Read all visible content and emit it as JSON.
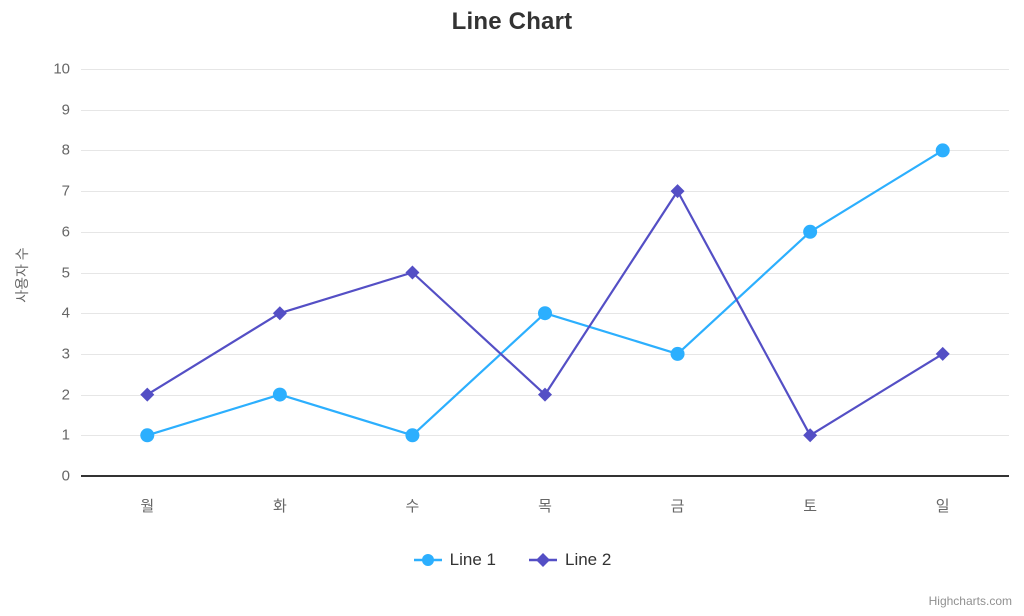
{
  "chart_data": {
    "type": "line",
    "title": "Line Chart",
    "xlabel": "",
    "ylabel": "사용자 수",
    "categories": [
      "월",
      "화",
      "수",
      "목",
      "금",
      "토",
      "일"
    ],
    "series": [
      {
        "name": "Line 1",
        "color": "#2caffe",
        "marker": "circle",
        "values": [
          1,
          2,
          1,
          4,
          3,
          6,
          8
        ]
      },
      {
        "name": "Line 2",
        "color": "#544fc5",
        "marker": "diamond",
        "values": [
          2,
          4,
          5,
          2,
          7,
          1,
          3
        ]
      }
    ],
    "ylim": [
      0,
      10
    ],
    "ytick_values": [
      0,
      1,
      2,
      3,
      4,
      5,
      6,
      7,
      8,
      9,
      10
    ],
    "ytick_labels": [
      "0",
      "1",
      "2",
      "3",
      "4",
      "5",
      "6",
      "7",
      "8",
      "9",
      "10"
    ],
    "grid": true,
    "legend_position": "bottom-center"
  },
  "credits": {
    "text": "Highcharts.com"
  },
  "colors": {
    "series_1": "#2caffe",
    "series_2": "#544fc5",
    "gridline": "#e6e6e6",
    "axis_line": "#333333",
    "tick_label": "#666666",
    "title": "#333333",
    "background": "#ffffff"
  }
}
